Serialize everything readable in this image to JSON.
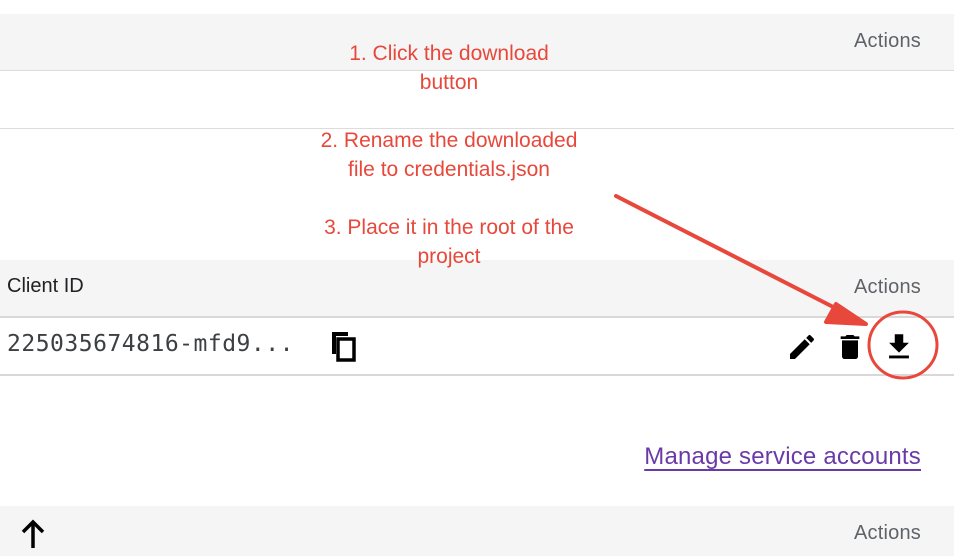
{
  "annotations": {
    "step1": "1. Click the download\nbutton",
    "step2": "2. Rename the downloaded\nfile to credentials.json",
    "step3": "3. Place it in the root of the\nproject"
  },
  "table1": {
    "actions_header": "Actions"
  },
  "oauth_table": {
    "client_id_header": "Client ID",
    "actions_header": "Actions",
    "row": {
      "client_id": "225035674816-mfd9...",
      "icons": [
        "copy-icon",
        "edit-icon",
        "delete-icon",
        "download-icon"
      ]
    }
  },
  "manage_link": "Manage service accounts",
  "table3": {
    "actions_header": "Actions",
    "sort_icon": "arrow-up-icon"
  },
  "colors": {
    "annotation": "#e8483b",
    "link": "#6a3aa8",
    "header_bg": "#f5f5f5"
  }
}
